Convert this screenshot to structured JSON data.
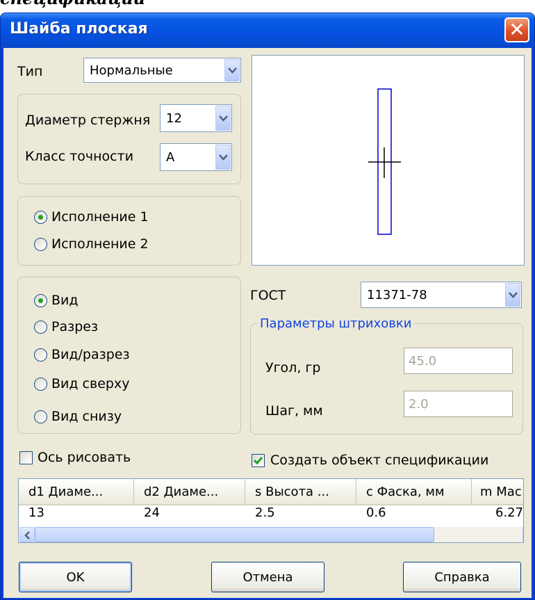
{
  "cut_heading": "спецификации",
  "window": {
    "title": "Шайба плоская",
    "close_icon": "close-icon"
  },
  "type_row": {
    "label": "Тип",
    "value": "Нормальные"
  },
  "rod": {
    "diameter_label": "Диаметр стержня",
    "diameter_value": "12",
    "accuracy_label": "Класс точности",
    "accuracy_value": "A"
  },
  "execution": {
    "options": [
      "Исполнение 1",
      "Исполнение 2"
    ],
    "selected": "Исполнение 1"
  },
  "view": {
    "options": [
      "Вид",
      "Разрез",
      "Вид/разрез",
      "Вид сверху",
      "Вид снизу"
    ],
    "selected": "Вид"
  },
  "gost": {
    "label": "ГОСТ",
    "value": "11371-78"
  },
  "hatch": {
    "title": "Параметры штриховки",
    "angle_label": "Угол, гр",
    "angle_value": "45.0",
    "step_label": "Шаг, мм",
    "step_value": "2.0"
  },
  "checkboxes": {
    "draw_axis": {
      "label": "Ось рисовать",
      "checked": false
    },
    "create_spec": {
      "label": "Создать объект спецификации",
      "checked": true
    }
  },
  "table": {
    "headers": [
      "d1 Диаме...",
      "d2 Диаме...",
      "s Высота ...",
      "c Фаска, мм",
      "m Мас"
    ],
    "row": [
      "13",
      "24",
      "2.5",
      "0.6",
      "6.27"
    ]
  },
  "buttons": {
    "ok": "OK",
    "cancel": "Отмена",
    "help": "Справка"
  },
  "colors": {
    "title_bar": "#0550e0",
    "dialog_bg": "#ece9d8",
    "group_title": "#1144dd",
    "preview_stroke": "#0000cc"
  }
}
